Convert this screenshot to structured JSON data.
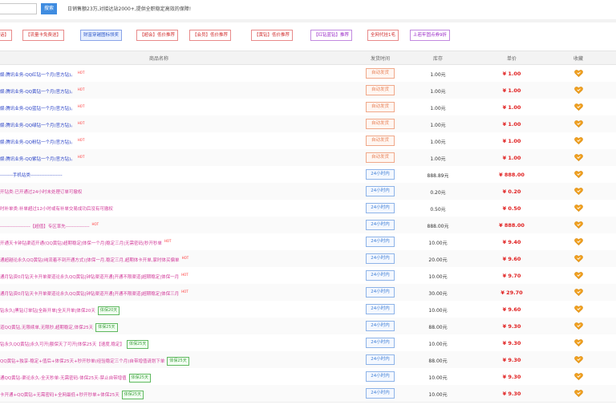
{
  "search": {
    "placeholder": "",
    "button_label": "搜索"
  },
  "tagline": "日销售额23万,对接达站2000+,提供全职稳定高效的保障!",
  "categories": [
    {
      "label": "话】",
      "style": "red"
    },
    {
      "label": "【流量卡免费送】",
      "style": "red"
    },
    {
      "label": "财富穿越图标领奖",
      "style": "blue"
    },
    {
      "label": "【超会】低价推荐",
      "style": "red"
    },
    {
      "label": "【会员】低价推荐",
      "style": "red"
    },
    {
      "label": "【黄钻】低价推荐",
      "style": "red"
    },
    {
      "label": "【红钻蓝钻】推荐",
      "style": "purple"
    },
    {
      "label": "全网代挂1毛",
      "style": "red"
    },
    {
      "label": "上若牢固点券9折",
      "style": "purple"
    }
  ],
  "table": {
    "headers": {
      "name": "商品名称",
      "time": "发货时间",
      "stock": "库存",
      "price": "单价",
      "fav": "收藏"
    },
    "rows": [
      {
        "name": "娱:腾讯业务-QQ红钻一个月(官方钻)。",
        "hot": "HOT",
        "badge": "",
        "status": "自动发货",
        "status_type": "auto",
        "qty": "1.00元",
        "price": "¥ 1.00",
        "color": "blue"
      },
      {
        "name": "娱:腾讯业务-QQ黄钻一个月(官方钻)。",
        "hot": "HOT",
        "badge": "",
        "status": "自动发货",
        "status_type": "auto",
        "qty": "1.00元",
        "price": "¥ 1.00",
        "color": "blue"
      },
      {
        "name": "娱:腾讯业务-QQ蓝钻一个月(官方钻)。",
        "hot": "HOT",
        "badge": "",
        "status": "自动发货",
        "status_type": "auto",
        "qty": "1.00元",
        "price": "¥ 1.00",
        "color": "blue"
      },
      {
        "name": "娱:腾讯业务-QQ绿钻一个月(官方钻)。",
        "hot": "HOT",
        "badge": "",
        "status": "自动发货",
        "status_type": "auto",
        "qty": "1.00元",
        "price": "¥ 1.00",
        "color": "blue"
      },
      {
        "name": "娱:腾讯业务-QQ粉钻一个月(官方钻)。",
        "hot": "HOT",
        "badge": "",
        "status": "自动发货",
        "status_type": "auto",
        "qty": "1.00元",
        "price": "¥ 1.00",
        "color": "blue"
      },
      {
        "name": "娱:腾讯业务-QQ紫钻一个月(官方钻)。",
        "hot": "HOT",
        "badge": "",
        "status": "自动发货",
        "status_type": "auto",
        "qty": "1.00元",
        "price": "¥ 1.00",
        "color": "blue"
      },
      {
        "name": "--------手机站类--------------------",
        "hot": "",
        "badge": "",
        "status": "24小时内",
        "status_type": "h24",
        "qty": "888.89元",
        "price": "¥ 888.00",
        "color": "blue"
      },
      {
        "name": "开钻类:已开通过24小时未处理订单可撤权",
        "hot": "",
        "badge": "",
        "status": "24小时内",
        "status_type": "h24",
        "qty": "0.20元",
        "price": "¥ 0.20",
        "color": "pink"
      },
      {
        "name": "时补单类:补单超过12小时或有补单交易成功后没有可撤权",
        "hot": "",
        "badge": "",
        "status": "24小时内",
        "status_type": "h24",
        "qty": "0.50元",
        "price": "¥ 0.50",
        "color": "pink"
      },
      {
        "name": "-------------------【超值】专区率先---------------",
        "hot": "HOT",
        "badge": "",
        "status": "24小时内",
        "status_type": "h24",
        "qty": "888.00元",
        "price": "¥ 888.00",
        "color": "pink"
      },
      {
        "name": "开通天卡钟钻渠道开通(QQ黄钻)超期稳定|体保一个月|稳定三月|无需密码|秒开秒单",
        "hot": "HOT",
        "badge": "",
        "status": "24小时内",
        "status_type": "h24",
        "qty": "10.00元",
        "price": "¥ 9.40",
        "color": "pink"
      },
      {
        "name": "通超越论永久QQ黄钻(纯流着不到开通方式)|体保一月,稳定三月,超期体卡开单,家时体买偏单",
        "hot": "HOT",
        "badge": "",
        "status": "24小时内",
        "status_type": "h24",
        "qty": "20.00元",
        "price": "¥ 9.60",
        "color": "pink"
      },
      {
        "name": "通月钻资0月钻天卡开单渠道论永久QQ黄钻|钟钻渠道开通|开通不限渠道|超期稳定|体保一月",
        "hot": "HOT",
        "badge": "",
        "status": "24小时内",
        "status_type": "h24",
        "qty": "10.00元",
        "price": "¥ 9.70",
        "color": "pink"
      },
      {
        "name": "通月钻资0月钻天卡开单渠道论永久QQ黄钻|钟钻渠道开通|开通不限渠道|超期稳定|体保三月",
        "hot": "HOT",
        "badge": "",
        "status": "24小时内",
        "status_type": "h24",
        "qty": "30.00元",
        "price": "¥ 29.70",
        "color": "pink"
      },
      {
        "name": "钻永久|黑钻订单钻|全新开单|全天开单|体保20天",
        "hot": "",
        "badge": "体保20天",
        "status": "24小时内",
        "status_type": "h24",
        "qty": "10.00元",
        "price": "¥ 9.60",
        "color": "pink"
      },
      {
        "name": "道QQ黄钻,无限续单,无限秒,超期稳定,体保25天",
        "hot": "",
        "badge": "体保25天",
        "status": "24小时内",
        "status_type": "h24",
        "qty": "88.00元",
        "price": "¥ 9.30",
        "color": "pink"
      },
      {
        "name": "钻永久QQ黄钻|永久可开|额保天了可开|体保25天【速度,稳定】",
        "hot": "",
        "badge": "体保25天",
        "status": "24小时内",
        "status_type": "h24",
        "qty": "10.00元",
        "price": "¥ 9.30",
        "color": "pink"
      },
      {
        "name": "QQ黄钻+独享-稳定+值后+体保25天+秒开秒单(经验稳定三个月)自带增值请划下单",
        "hot": "",
        "badge": "体保25天",
        "status": "24小时内",
        "status_type": "h24",
        "qty": "88.00元",
        "price": "¥ 9.30",
        "color": "pink"
      },
      {
        "name": "通QQ黄钻-渠论永久-全天秒单-无需密码-体保25天-禁止自带增值",
        "hot": "",
        "badge": "体保25天",
        "status": "24小时内",
        "status_type": "h24",
        "qty": "10.00元",
        "price": "¥ 9.30",
        "color": "pink"
      },
      {
        "name": "卡开通+QQ黄钻+无需密码+全网最低+秒开秒单+体保25天",
        "hot": "",
        "badge": "体保25天",
        "status": "24小时内",
        "status_type": "h24",
        "qty": "10.00元",
        "price": "¥ 9.30",
        "color": "pink"
      }
    ]
  },
  "colors": {
    "accent": "#3f8ce0",
    "price": "#e02020",
    "pink_text": "#d23b9a",
    "blue_text": "#2b43c7",
    "fav": "#f0a020"
  },
  "icons": {
    "favorite": "favorite-heart-icon"
  }
}
